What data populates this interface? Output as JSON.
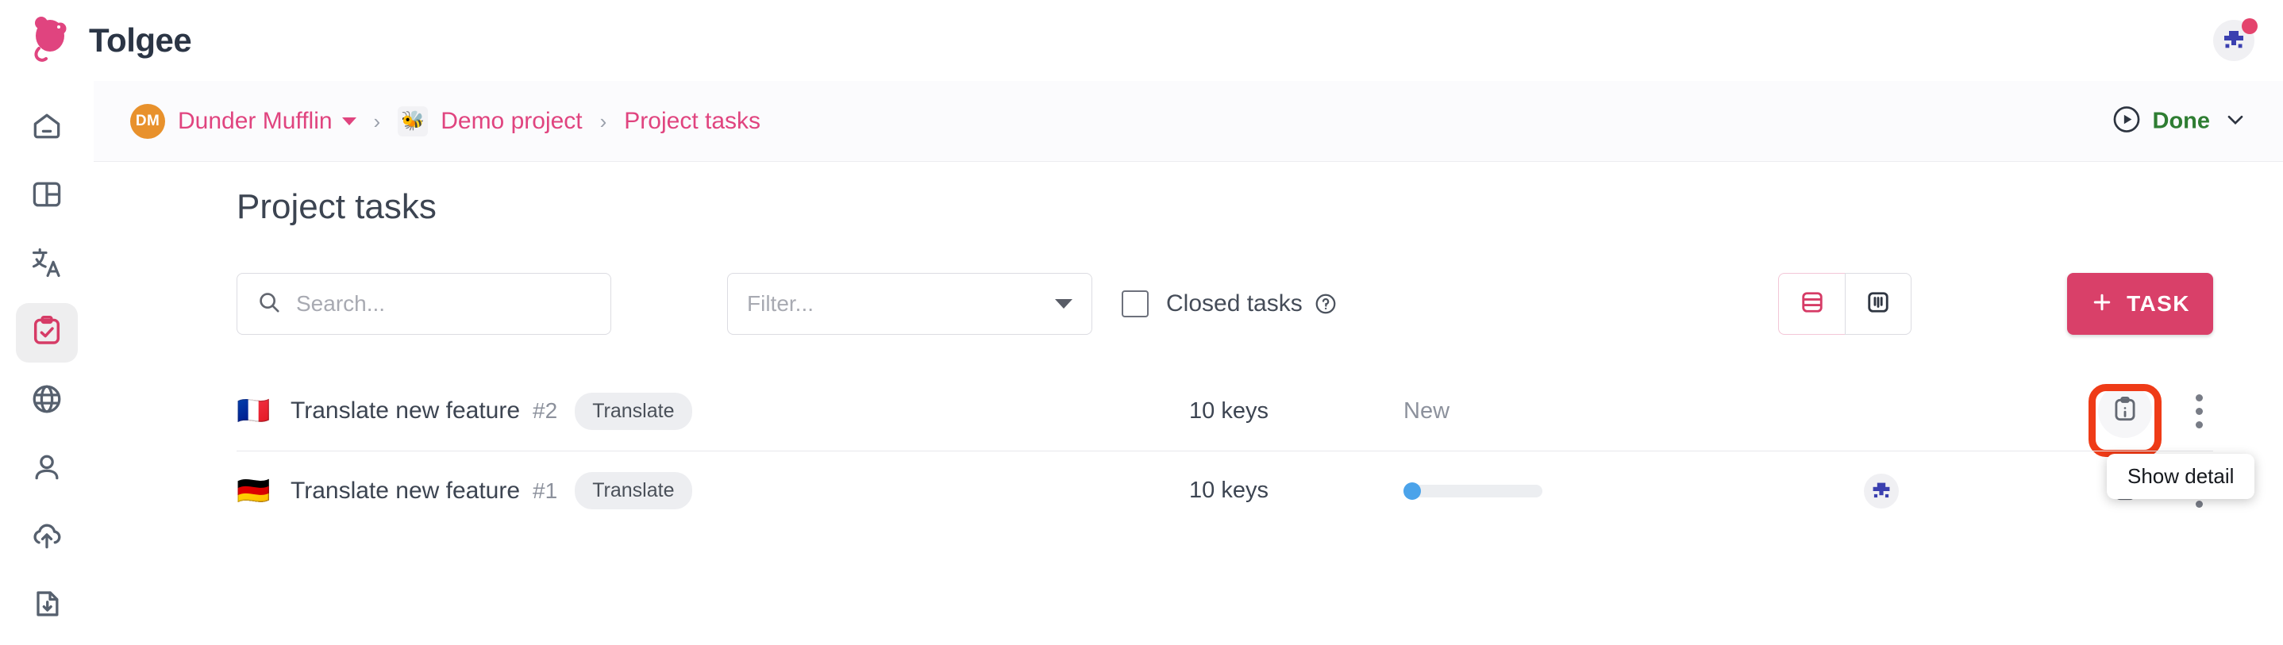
{
  "app": {
    "brand_name": "Tolgee",
    "brand_color": "#e0447f",
    "accent_color": "#d94069"
  },
  "topbar": {
    "logo_icon": "tolgee-mouse-logo",
    "user_avatar_icon": "identicon-avatar",
    "notification_badge_color": "#e4446d"
  },
  "breadcrumb": {
    "org_initials": "DM",
    "org_name": "Dunder Mufflin",
    "org_avatar_color": "#e8912c",
    "separator": "›",
    "project_emoji": "🐝",
    "project_name": "Demo project",
    "current": "Project tasks",
    "status": {
      "icon": "play-circle-icon",
      "label": "Done",
      "color": "#2e7d32",
      "caret_icon": "chevron-down-icon"
    }
  },
  "sidebar": {
    "items": [
      {
        "name": "home",
        "icon": "home-icon",
        "active": false
      },
      {
        "name": "dashboard",
        "icon": "layout-dashboard-icon",
        "active": false
      },
      {
        "name": "translations",
        "icon": "translate-icon",
        "active": false
      },
      {
        "name": "tasks",
        "icon": "clipboard-check-icon",
        "active": true
      },
      {
        "name": "languages",
        "icon": "globe-icon",
        "active": false
      },
      {
        "name": "members",
        "icon": "user-icon",
        "active": false
      },
      {
        "name": "import",
        "icon": "cloud-upload-icon",
        "active": false
      },
      {
        "name": "export",
        "icon": "file-download-icon",
        "active": false
      }
    ],
    "active_color": "#d94069"
  },
  "main": {
    "page_title": "Project tasks",
    "toolbar": {
      "search": {
        "icon": "search-icon",
        "value": "",
        "placeholder": "Search..."
      },
      "filter": {
        "value": "",
        "placeholder": "Filter...",
        "caret_icon": "caret-down-icon"
      },
      "closed_tasks": {
        "label": "Closed tasks",
        "checked": false,
        "help_icon": "help-circle-icon"
      },
      "view_toggle": {
        "list_icon": "list-view-icon",
        "board_icon": "board-view-icon",
        "active": "list"
      },
      "new_task_button": {
        "plus_icon": "plus-icon",
        "label": "TASK"
      }
    },
    "tasks": [
      {
        "flag": "🇫🇷",
        "flag_name": "flag-france",
        "name": "Translate new feature",
        "number": "#2",
        "type_chip": "Translate",
        "keys": "10 keys",
        "state_text": "New",
        "has_progress": false,
        "progress_percent": 0,
        "assignee_avatar": null,
        "detail_icon": "clipboard-info-icon",
        "menu_icon": "kebab-menu-icon",
        "highlighted": true
      },
      {
        "flag": "🇩🇪",
        "flag_name": "flag-germany",
        "name": "Translate new feature",
        "number": "#1",
        "type_chip": "Translate",
        "keys": "10 keys",
        "state_text": "",
        "has_progress": true,
        "progress_percent": 3,
        "assignee_avatar": "identicon-avatar",
        "detail_icon": "clipboard-info-icon",
        "menu_icon": "kebab-menu-icon",
        "highlighted": false
      }
    ],
    "tooltip": {
      "text": "Show detail"
    }
  }
}
